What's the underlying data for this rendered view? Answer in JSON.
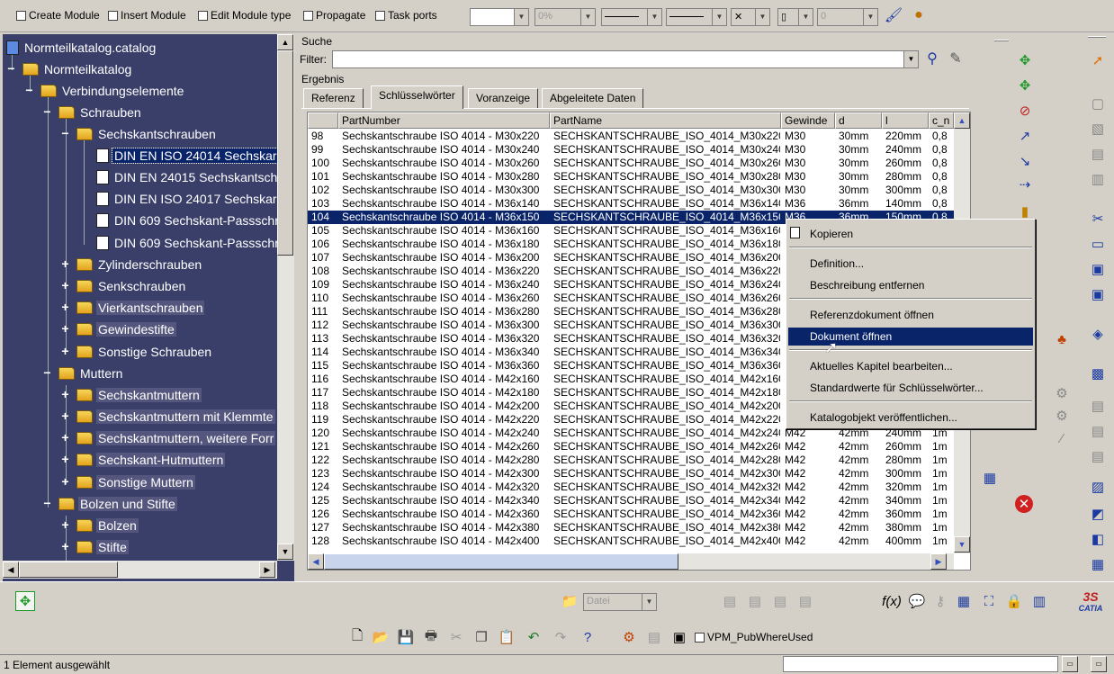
{
  "toolbar": {
    "checkboxes": [
      "Create Module",
      "Insert Module",
      "Edit Module type",
      "Propagate",
      "Task ports"
    ],
    "combo_percent": "0%",
    "combo_zero": "0"
  },
  "tree": {
    "items": [
      {
        "label": "Normteilkatalog.catalog"
      },
      {
        "label": "Normteilkatalog"
      },
      {
        "label": "Verbindungselemente"
      },
      {
        "label": "Schrauben"
      },
      {
        "label": "Sechskantschrauben"
      },
      {
        "label": "DIN EN ISO 24014 Sechskar"
      },
      {
        "label": "DIN EN 24015 Sechskantsch"
      },
      {
        "label": "DIN EN ISO 24017 Sechskar"
      },
      {
        "label": "DIN 609 Sechskant-Passschr"
      },
      {
        "label": "DIN 609 Sechskant-Passschr"
      },
      {
        "label": "Zylinderschrauben"
      },
      {
        "label": "Senkschrauben"
      },
      {
        "label": "Vierkantschrauben"
      },
      {
        "label": "Gewindestifte"
      },
      {
        "label": "Sonstige Schrauben"
      },
      {
        "label": "Muttern"
      },
      {
        "label": "Sechskantmuttern"
      },
      {
        "label": "Sechskantmuttern mit Klemmte"
      },
      {
        "label": "Sechskantmuttern, weitere Forr"
      },
      {
        "label": "Sechskant-Hutmuttern"
      },
      {
        "label": "Sonstige Muttern"
      },
      {
        "label": "Bolzen und Stifte"
      },
      {
        "label": "Bolzen"
      },
      {
        "label": "Stifte"
      }
    ]
  },
  "catalog": {
    "suche_label": "Suche",
    "filter_label": "Filter:",
    "ergebnis_label": "Ergebnis",
    "tabs": [
      "Referenz",
      "Schlüsselwörter",
      "Voranzeige",
      "Abgeleitete Daten"
    ],
    "columns": [
      "PartNumber",
      "PartName",
      "Gewinde",
      "d",
      "l",
      "c_n"
    ],
    "rows": [
      {
        "n": "98",
        "pn": "Sechskantschraube ISO 4014 - M30x220",
        "name": "SECHSKANTSCHRAUBE_ISO_4014_M30x220",
        "g": "M30",
        "d": "30mm",
        "l": "220mm",
        "c": "0,8"
      },
      {
        "n": "99",
        "pn": "Sechskantschraube ISO 4014 - M30x240",
        "name": "SECHSKANTSCHRAUBE_ISO_4014_M30x240",
        "g": "M30",
        "d": "30mm",
        "l": "240mm",
        "c": "0,8"
      },
      {
        "n": "100",
        "pn": "Sechskantschraube ISO 4014 - M30x260",
        "name": "SECHSKANTSCHRAUBE_ISO_4014_M30x260",
        "g": "M30",
        "d": "30mm",
        "l": "260mm",
        "c": "0,8"
      },
      {
        "n": "101",
        "pn": "Sechskantschraube ISO 4014 - M30x280",
        "name": "SECHSKANTSCHRAUBE_ISO_4014_M30x280",
        "g": "M30",
        "d": "30mm",
        "l": "280mm",
        "c": "0,8"
      },
      {
        "n": "102",
        "pn": "Sechskantschraube ISO 4014 - M30x300",
        "name": "SECHSKANTSCHRAUBE_ISO_4014_M30x300",
        "g": "M30",
        "d": "30mm",
        "l": "300mm",
        "c": "0,8"
      },
      {
        "n": "103",
        "pn": "Sechskantschraube ISO 4014 - M36x140",
        "name": "SECHSKANTSCHRAUBE_ISO_4014_M36x140",
        "g": "M36",
        "d": "36mm",
        "l": "140mm",
        "c": "0,8"
      },
      {
        "n": "104",
        "pn": "Sechskantschraube ISO 4014 - M36x150",
        "name": "SECHSKANTSCHRAUBE_ISO_4014_M36x150",
        "g": "M36",
        "d": "36mm",
        "l": "150mm",
        "c": "0,8"
      },
      {
        "n": "105",
        "pn": "Sechskantschraube ISO 4014 - M36x160",
        "name": "SECHSKANTSCHRAUBE_ISO_4014_M36x160",
        "g": "",
        "d": "",
        "l": "",
        "c": ""
      },
      {
        "n": "106",
        "pn": "Sechskantschraube ISO 4014 - M36x180",
        "name": "SECHSKANTSCHRAUBE_ISO_4014_M36x180",
        "g": "",
        "d": "",
        "l": "",
        "c": ""
      },
      {
        "n": "107",
        "pn": "Sechskantschraube ISO 4014 - M36x200",
        "name": "SECHSKANTSCHRAUBE_ISO_4014_M36x200",
        "g": "",
        "d": "",
        "l": "",
        "c": ""
      },
      {
        "n": "108",
        "pn": "Sechskantschraube ISO 4014 - M36x220",
        "name": "SECHSKANTSCHRAUBE_ISO_4014_M36x220",
        "g": "",
        "d": "",
        "l": "",
        "c": ""
      },
      {
        "n": "109",
        "pn": "Sechskantschraube ISO 4014 - M36x240",
        "name": "SECHSKANTSCHRAUBE_ISO_4014_M36x240",
        "g": "",
        "d": "",
        "l": "",
        "c": ""
      },
      {
        "n": "110",
        "pn": "Sechskantschraube ISO 4014 - M36x260",
        "name": "SECHSKANTSCHRAUBE_ISO_4014_M36x260",
        "g": "",
        "d": "",
        "l": "",
        "c": ""
      },
      {
        "n": "111",
        "pn": "Sechskantschraube ISO 4014 - M36x280",
        "name": "SECHSKANTSCHRAUBE_ISO_4014_M36x280",
        "g": "",
        "d": "",
        "l": "",
        "c": ""
      },
      {
        "n": "112",
        "pn": "Sechskantschraube ISO 4014 - M36x300",
        "name": "SECHSKANTSCHRAUBE_ISO_4014_M36x300",
        "g": "",
        "d": "",
        "l": "",
        "c": ""
      },
      {
        "n": "113",
        "pn": "Sechskantschraube ISO 4014 - M36x320",
        "name": "SECHSKANTSCHRAUBE_ISO_4014_M36x320",
        "g": "",
        "d": "",
        "l": "",
        "c": ""
      },
      {
        "n": "114",
        "pn": "Sechskantschraube ISO 4014 - M36x340",
        "name": "SECHSKANTSCHRAUBE_ISO_4014_M36x340",
        "g": "",
        "d": "",
        "l": "",
        "c": ""
      },
      {
        "n": "115",
        "pn": "Sechskantschraube ISO 4014 - M36x360",
        "name": "SECHSKANTSCHRAUBE_ISO_4014_M36x360",
        "g": "",
        "d": "",
        "l": "",
        "c": ""
      },
      {
        "n": "116",
        "pn": "Sechskantschraube ISO 4014 - M42x160",
        "name": "SECHSKANTSCHRAUBE_ISO_4014_M42x160",
        "g": "",
        "d": "",
        "l": "",
        "c": ""
      },
      {
        "n": "117",
        "pn": "Sechskantschraube ISO 4014 - M42x180",
        "name": "SECHSKANTSCHRAUBE_ISO_4014_M42x180",
        "g": "",
        "d": "",
        "l": "",
        "c": ""
      },
      {
        "n": "118",
        "pn": "Sechskantschraube ISO 4014 - M42x200",
        "name": "SECHSKANTSCHRAUBE_ISO_4014_M42x200",
        "g": "",
        "d": "",
        "l": "",
        "c": ""
      },
      {
        "n": "119",
        "pn": "Sechskantschraube ISO 4014 - M42x220",
        "name": "SECHSKANTSCHRAUBE_ISO_4014_M42x220",
        "g": "",
        "d": "",
        "l": "",
        "c": ""
      },
      {
        "n": "120",
        "pn": "Sechskantschraube ISO 4014 - M42x240",
        "name": "SECHSKANTSCHRAUBE_ISO_4014_M42x240",
        "g": "M42",
        "d": "42mm",
        "l": "240mm",
        "c": "1m"
      },
      {
        "n": "121",
        "pn": "Sechskantschraube ISO 4014 - M42x260",
        "name": "SECHSKANTSCHRAUBE_ISO_4014_M42x260",
        "g": "M42",
        "d": "42mm",
        "l": "260mm",
        "c": "1m"
      },
      {
        "n": "122",
        "pn": "Sechskantschraube ISO 4014 - M42x280",
        "name": "SECHSKANTSCHRAUBE_ISO_4014_M42x280",
        "g": "M42",
        "d": "42mm",
        "l": "280mm",
        "c": "1m"
      },
      {
        "n": "123",
        "pn": "Sechskantschraube ISO 4014 - M42x300",
        "name": "SECHSKANTSCHRAUBE_ISO_4014_M42x300",
        "g": "M42",
        "d": "42mm",
        "l": "300mm",
        "c": "1m"
      },
      {
        "n": "124",
        "pn": "Sechskantschraube ISO 4014 - M42x320",
        "name": "SECHSKANTSCHRAUBE_ISO_4014_M42x320",
        "g": "M42",
        "d": "42mm",
        "l": "320mm",
        "c": "1m"
      },
      {
        "n": "125",
        "pn": "Sechskantschraube ISO 4014 - M42x340",
        "name": "SECHSKANTSCHRAUBE_ISO_4014_M42x340",
        "g": "M42",
        "d": "42mm",
        "l": "340mm",
        "c": "1m"
      },
      {
        "n": "126",
        "pn": "Sechskantschraube ISO 4014 - M42x360",
        "name": "SECHSKANTSCHRAUBE_ISO_4014_M42x360",
        "g": "M42",
        "d": "42mm",
        "l": "360mm",
        "c": "1m"
      },
      {
        "n": "127",
        "pn": "Sechskantschraube ISO 4014 - M42x380",
        "name": "SECHSKANTSCHRAUBE_ISO_4014_M42x380",
        "g": "M42",
        "d": "42mm",
        "l": "380mm",
        "c": "1m"
      },
      {
        "n": "128",
        "pn": "Sechskantschraube ISO 4014 - M42x400",
        "name": "SECHSKANTSCHRAUBE_ISO_4014_M42x400",
        "g": "M42",
        "d": "42mm",
        "l": "400mm",
        "c": "1m"
      }
    ]
  },
  "context_menu": {
    "items": [
      "Kopieren",
      "Definition...",
      "Beschreibung entfernen",
      "Referenzdokument öffnen",
      "Dokument öffnen",
      "Aktuelles Kapitel bearbeiten...",
      "Standardwerte für Schlüsselwörter...",
      "Katalogobjekt veröffentlichen..."
    ]
  },
  "bottom": {
    "datei_combo": "Datei",
    "vpm_label": "VPM_PubWhereUsed",
    "catia_logo": "CATIA"
  },
  "status": {
    "text": "1 Element ausgewählt"
  },
  "colors": {
    "tree_bg": "#3a3f6a",
    "selection": "#0a246a",
    "face": "#d4d0c8"
  }
}
